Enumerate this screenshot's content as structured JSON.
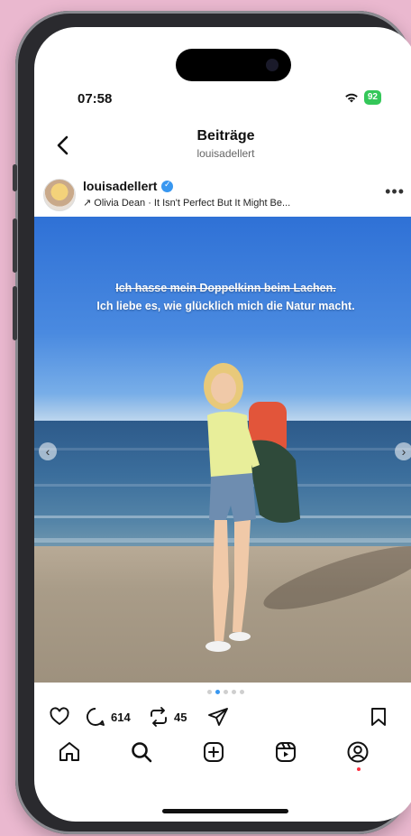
{
  "status": {
    "time": "07:58",
    "battery": "92"
  },
  "header": {
    "title": "Beiträge",
    "subtitle": "louisadellert"
  },
  "post": {
    "username": "louisadellert",
    "music": "↗ Olivia Dean · It Isn't Perfect But It Might Be...",
    "overlay_line1": "Ich hasse mein Doppelkinn beim Lachen.",
    "overlay_line2": "Ich liebe es, wie glücklich mich die Natur macht.",
    "carousel": {
      "total": 5,
      "active_index": 1
    }
  },
  "actions": {
    "comments": "614",
    "reposts": "45"
  },
  "icons": {
    "back": "back-icon",
    "more": "more-icon",
    "like": "heart-icon",
    "comment": "comment-icon",
    "repost": "repost-icon",
    "share": "send-icon",
    "save": "bookmark-icon",
    "home": "home-icon",
    "search": "search-icon",
    "create": "plus-square-icon",
    "reels": "reels-icon",
    "profile": "profile-icon"
  },
  "colors": {
    "accent": "#3897f0",
    "battery": "#34c759",
    "notification": "#ff3040"
  }
}
